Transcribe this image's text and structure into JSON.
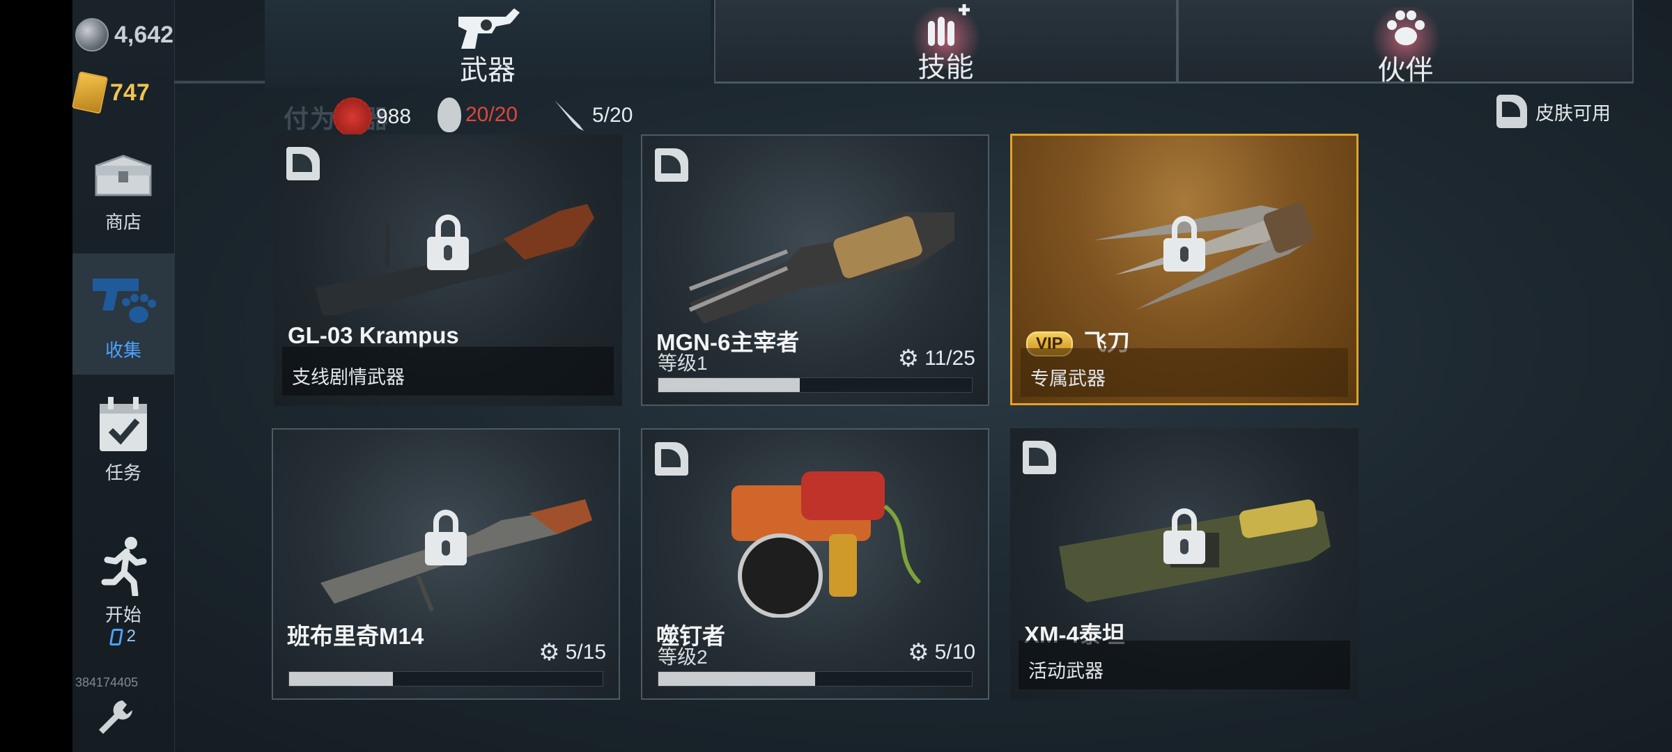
{
  "currencies": {
    "silver": "4,642",
    "gold": "747"
  },
  "nav": [
    {
      "label": "商店",
      "icon": "chest-icon"
    },
    {
      "label": "收集",
      "icon": "collection-icon"
    },
    {
      "label": "任务",
      "icon": "calendar-check-icon"
    },
    {
      "label": "开始",
      "icon": "running-man-icon",
      "badge": "2"
    }
  ],
  "player_id": "384174405",
  "tabs": [
    {
      "label": "武器",
      "icon": "revolver-icon",
      "active": true
    },
    {
      "label": "技能",
      "icon": "ammo-plus-icon"
    },
    {
      "label": "伙伴",
      "icon": "paw-icon"
    }
  ],
  "section_title_faded": "付为武器",
  "resources": {
    "caps": "988",
    "grenades": "20/20",
    "knives": "5/20"
  },
  "skin_available": "皮肤可用",
  "cards": [
    {
      "name": "GL-03 Krampus",
      "subtitle": "支线剧情武器",
      "locked": true
    },
    {
      "name": "MGN-6主宰者",
      "level": "等级1",
      "count": "11/25",
      "progress": 0.45
    },
    {
      "name": "飞刀",
      "vip_label": "VIP",
      "subtitle": "专属武器",
      "locked": true,
      "vip": true
    },
    {
      "name": "班布里奇M14",
      "count": "5/15",
      "progress": 0.33,
      "locked": true
    },
    {
      "name": "噬钉者",
      "level": "等级2",
      "count": "5/10",
      "progress": 0.5
    },
    {
      "name": "XM-4泰坦",
      "subtitle": "活动武器",
      "locked": true
    }
  ],
  "colors": {
    "accent_blue": "#4da3ff",
    "vip_gold": "#e3a227",
    "resource_red": "#e0463c"
  }
}
